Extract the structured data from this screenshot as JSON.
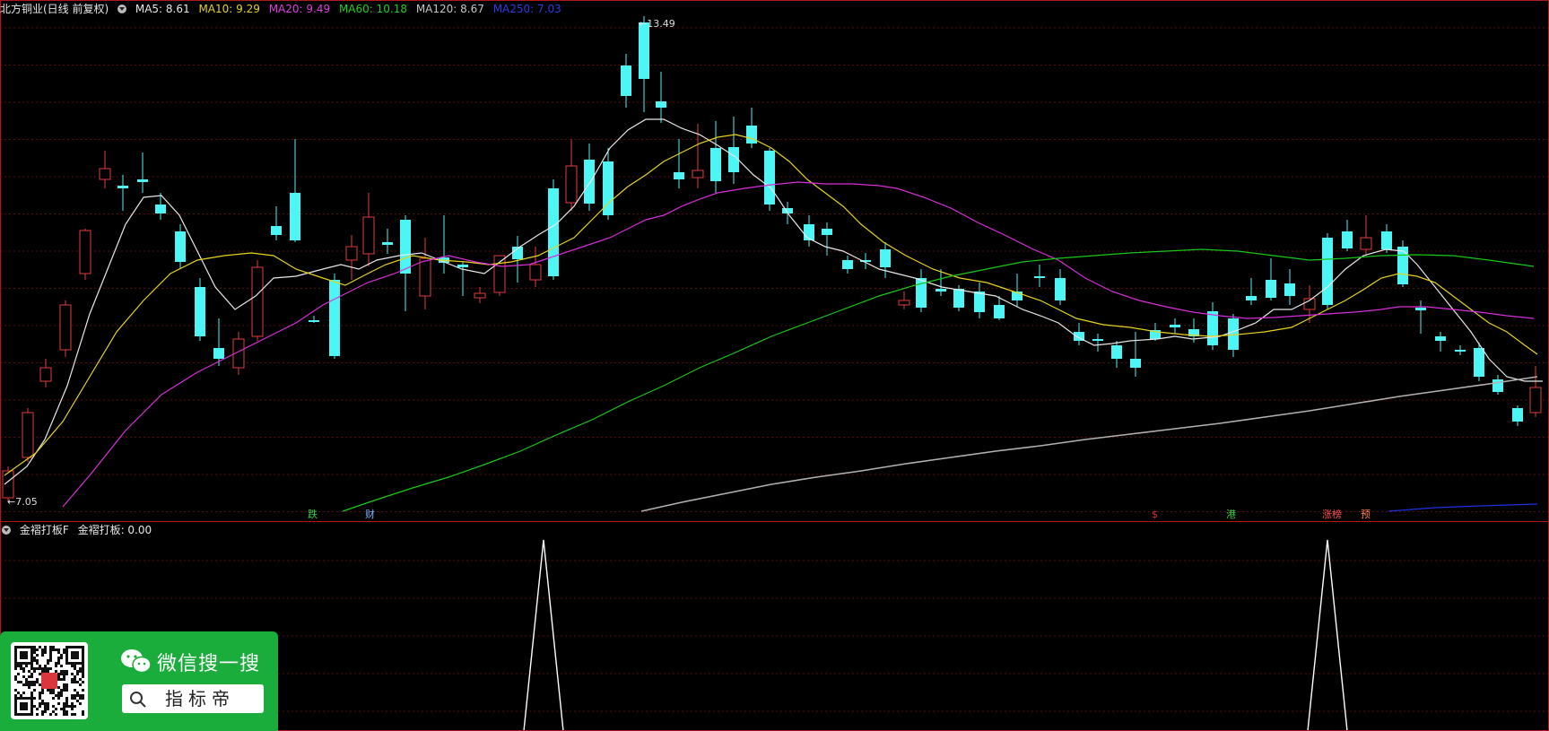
{
  "main_header": {
    "title": "北方铜业(日线 前复权)",
    "ma5": "MA5: 8.61",
    "ma10": "MA10: 9.29",
    "ma20": "MA20: 9.49",
    "ma60": "MA60: 10.18",
    "ma120": "MA120: 8.67",
    "ma250": "MA250: 7.03"
  },
  "price_labels": {
    "high": "13.49",
    "low": "7.05"
  },
  "markers": [
    {
      "text": "跌",
      "color": "#3cd13c"
    },
    {
      "text": "财",
      "color": "#7fb4ff"
    },
    {
      "text": "$",
      "color": "#e03030"
    },
    {
      "text": "港",
      "color": "#3cd13c"
    },
    {
      "text": "涨榜",
      "color": "#ff5050"
    },
    {
      "text": "预",
      "color": "#ff8040"
    }
  ],
  "indicator_header": {
    "name": "金褶打板F",
    "value": "金褶打板: 0.00"
  },
  "colors": {
    "up": "#e03b3b",
    "down": "#4ef5f5",
    "ma5": "#e8e8e8",
    "ma10": "#e6d31f",
    "ma20": "#d92ed9",
    "ma60": "#18c818",
    "ma120": "#b5b0b0",
    "ma250": "#1f2fe0",
    "border": "#b01818",
    "grid": "#5a0d0d"
  },
  "wechat_ad": {
    "title": "微信搜一搜",
    "search_text": "指标帝",
    "icon": "wechat-icon"
  }
}
